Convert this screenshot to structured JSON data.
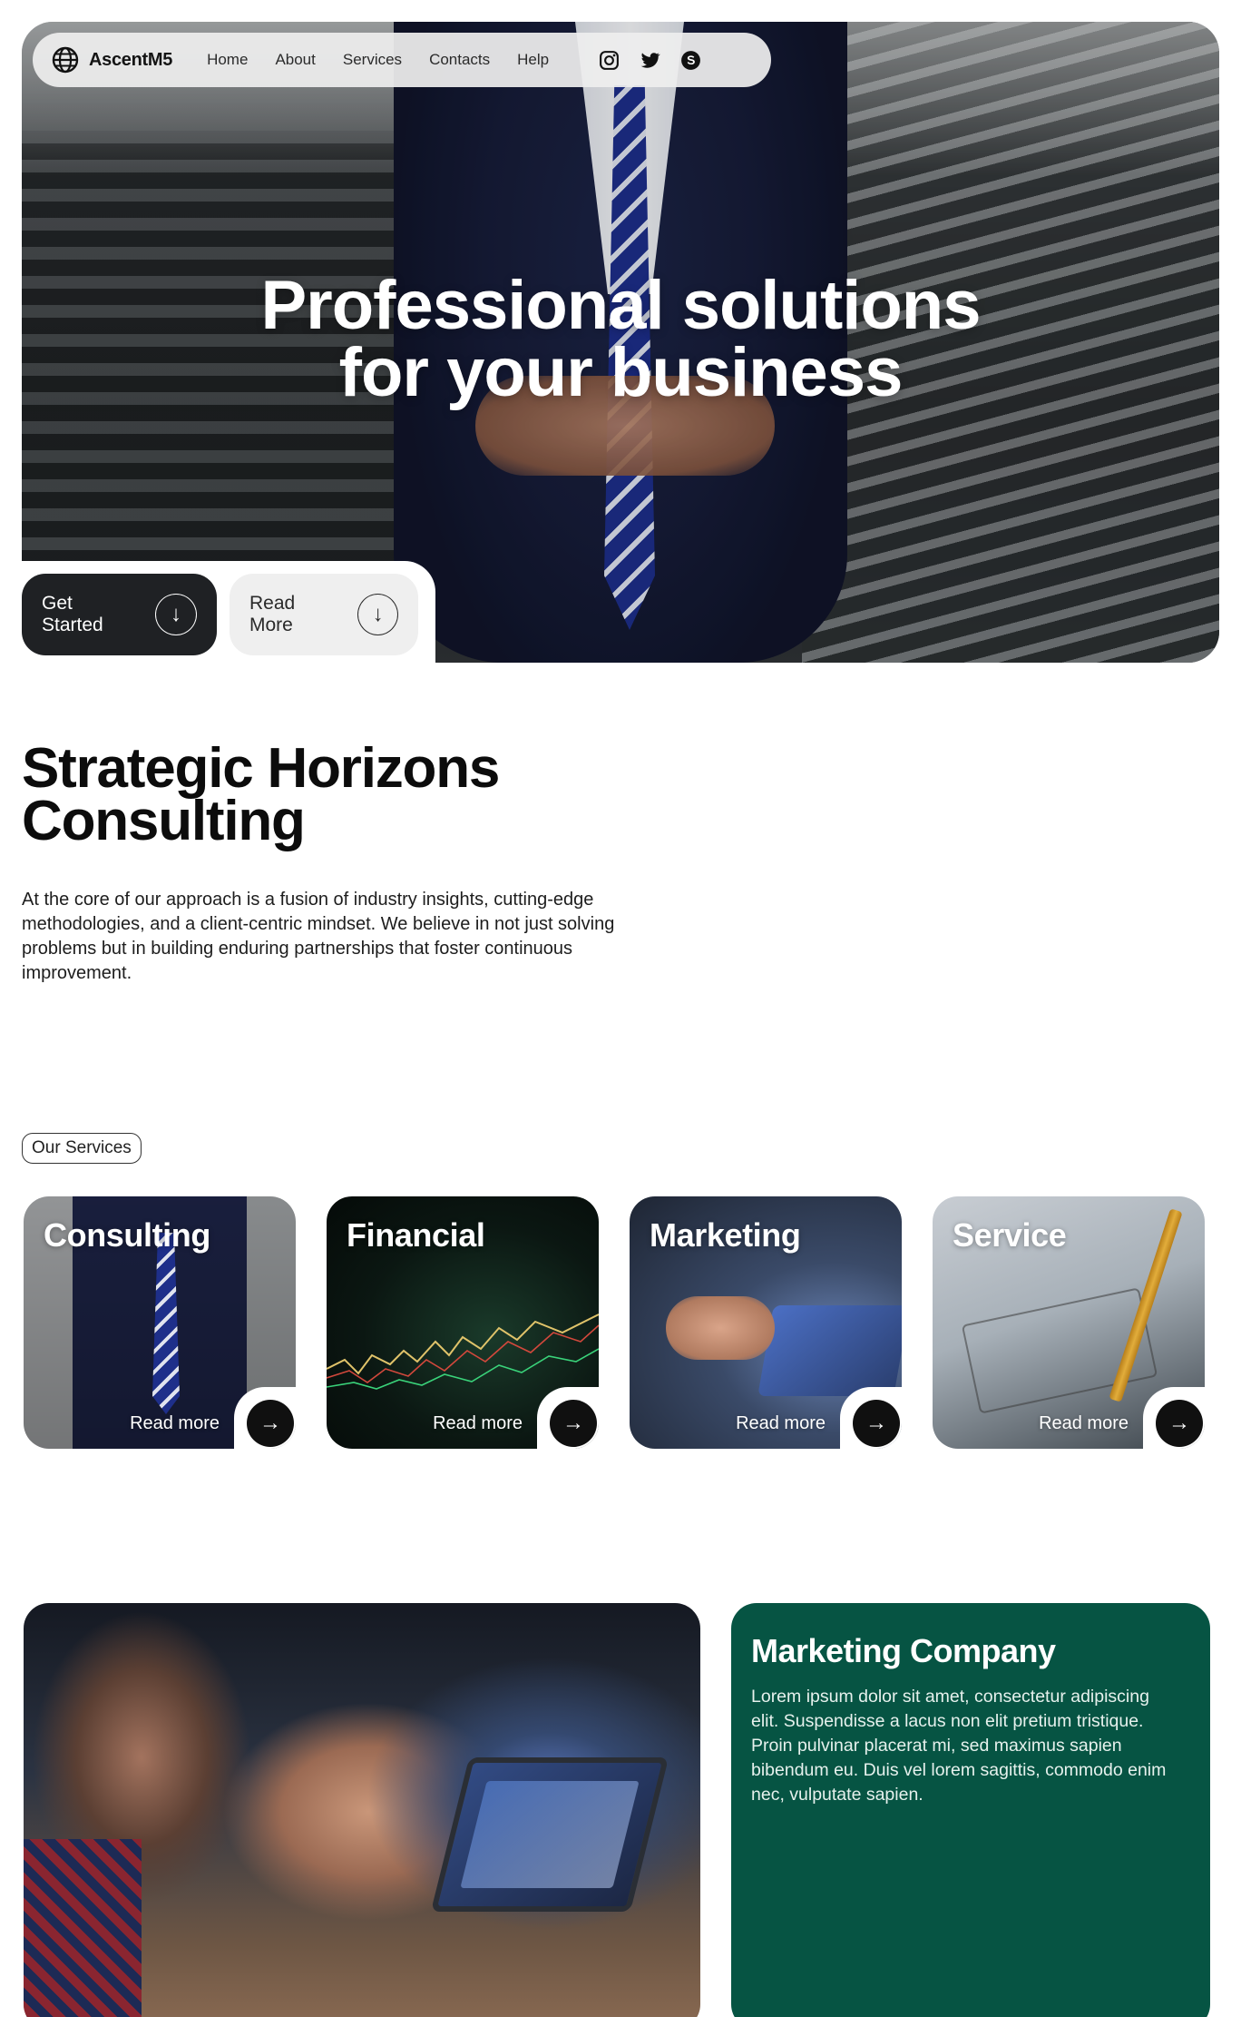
{
  "nav": {
    "brand": "AscentM5",
    "links": [
      "Home",
      "About",
      "Services",
      "Contacts",
      "Help"
    ],
    "social_icons": [
      "instagram-icon",
      "twitter-icon",
      "skype-icon"
    ]
  },
  "hero": {
    "title_line1": "Professional solutions",
    "title_line2": "for your business",
    "get_started_label": "Get Started",
    "read_more_label": "Read More"
  },
  "intro": {
    "title_line1": "Strategic Horizons",
    "title_line2": "Consulting",
    "text": "At the core of our approach is a fusion of industry insights, cutting-edge methodologies, and a client-centric mindset. We believe in not just solving problems but in building enduring partnerships that foster continuous improvement."
  },
  "services": {
    "badge": "Our Services",
    "cards": [
      {
        "title": "Consulting",
        "link": "Read more"
      },
      {
        "title": "Financial",
        "link": "Read more"
      },
      {
        "title": "Marketing",
        "link": "Read more"
      },
      {
        "title": "Service",
        "link": "Read more"
      }
    ]
  },
  "feature": {
    "title": "Marketing Company",
    "text": "Lorem ipsum dolor sit amet, consectetur adipiscing elit. Suspendisse a lacus non elit pretium tristique. Proin pulvinar placerat mi, sed maximus sapien bibendum eu. Duis vel lorem sagittis, commodo enim nec, vulputate sapien."
  },
  "colors": {
    "dark_button": "#1f2124",
    "light_button": "#efefef",
    "feature_green": "#065443"
  }
}
